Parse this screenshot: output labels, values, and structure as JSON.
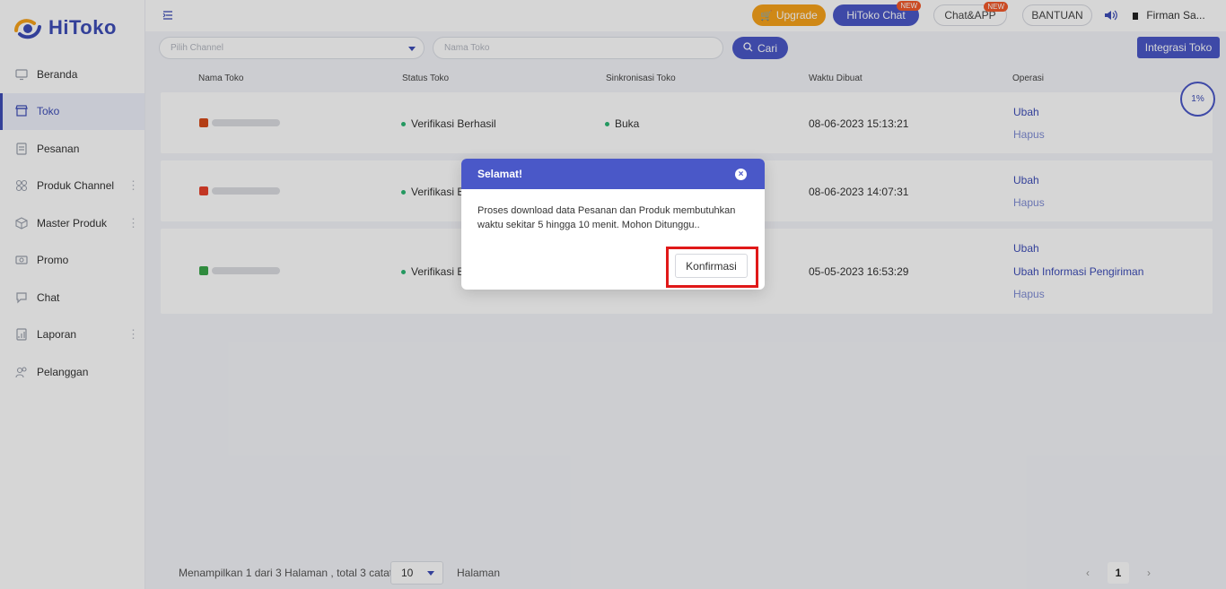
{
  "app": {
    "brand": "HiToko"
  },
  "sidebar": {
    "items": [
      {
        "label": "Beranda",
        "icon": "monitor-icon",
        "active": false,
        "has_more": false
      },
      {
        "label": "Toko",
        "icon": "store-icon",
        "active": true,
        "has_more": false
      },
      {
        "label": "Pesanan",
        "icon": "orders-icon",
        "active": false,
        "has_more": false
      },
      {
        "label": "Produk Channel",
        "icon": "grid-icon",
        "active": false,
        "has_more": true
      },
      {
        "label": "Master Produk",
        "icon": "box-icon",
        "active": false,
        "has_more": true
      },
      {
        "label": "Promo",
        "icon": "promo-icon",
        "active": false,
        "has_more": false
      },
      {
        "label": "Chat",
        "icon": "chat-icon",
        "active": false,
        "has_more": false
      },
      {
        "label": "Laporan",
        "icon": "report-icon",
        "active": false,
        "has_more": true
      },
      {
        "label": "Pelanggan",
        "icon": "customers-icon",
        "active": false,
        "has_more": false
      }
    ]
  },
  "topbar": {
    "upgrade_label": "Upgrade",
    "hitoko_chat_label": "HiToko Chat",
    "chat_app_label": "Chat&APP",
    "help_label": "BANTUAN",
    "new_badge": "NEW",
    "user_name": "Firman Sa..."
  },
  "filters": {
    "channel_placeholder": "Pilih Channel",
    "shop_name_placeholder": "Nama Toko",
    "search_label": "Cari",
    "integrate_label": "Integrasi Toko"
  },
  "table": {
    "columns": [
      "Nama Toko",
      "Status Toko",
      "Sinkronisasi Toko",
      "Waktu Dibuat",
      "Operasi"
    ],
    "rows": [
      {
        "status": "Verifikasi Berhasil",
        "sync": "Buka",
        "created": "08-06-2023 15:13:21",
        "operations": [
          "Ubah",
          "Hapus"
        ],
        "icon_color": "#d64a1a"
      },
      {
        "status": "Verifikasi Berhasil",
        "sync": "",
        "created": "08-06-2023 14:07:31",
        "operations": [
          "Ubah",
          "Hapus"
        ],
        "icon_color": "#e8412c"
      },
      {
        "status": "Verifikasi Berhasil",
        "sync": "",
        "created": "05-05-2023 16:53:29",
        "operations": [
          "Ubah",
          "Ubah Informasi Pengiriman",
          "Hapus"
        ],
        "icon_color": "#3aa64a"
      }
    ]
  },
  "progress": {
    "label": "1%",
    "value": 0.01
  },
  "footer": {
    "summary": "Menampilkan 1 dari 3 Halaman , total 3 catatan",
    "page_size": "10",
    "page_label": "Halaman",
    "current_page": "1",
    "prev": "‹",
    "next": "›"
  },
  "modal": {
    "title": "Selamat!",
    "message": "Proses download data Pesanan dan Produk membutuhkan waktu sekitar 5 hingga 10 menit. Mohon Ditunggu..",
    "confirm_label": "Konfirmasi",
    "close_glyph": "×"
  },
  "colors": {
    "primary": "#4a58c8",
    "upgrade": "#f7a21b",
    "success": "#2bb673",
    "highlight": "#e01818"
  }
}
